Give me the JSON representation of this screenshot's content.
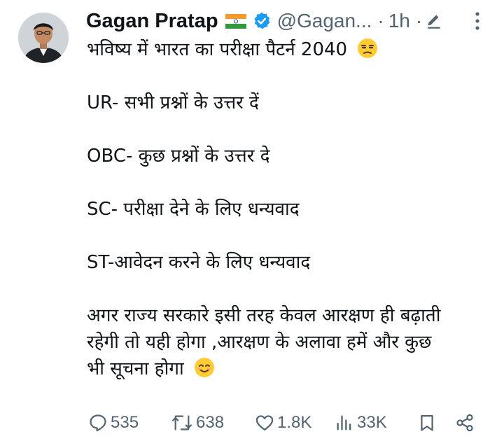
{
  "author": {
    "name": "Gagan Pratap",
    "handle": "@Gagan...",
    "time": "1h",
    "separator": "·"
  },
  "icons": {
    "avatar": "profile-photo",
    "flag": "india-flag-icon",
    "verified": "verified-badge-icon",
    "edit": "pencil-icon",
    "more": "more-vertical-icon",
    "emoji_1": "unamused-face-emoji",
    "emoji_2": "smiling-face-emoji"
  },
  "colors": {
    "text": "#0f1419",
    "muted": "#536471",
    "verified": "#1d9bf0",
    "emoji": "#ffcc33"
  },
  "tweet": {
    "line_1": "भविष्य में भारत का परीक्षा पैटर्न 2040",
    "line_2": "UR- सभी प्रश्नों के उत्तर दें",
    "line_3": "OBC- कुछ प्रश्नों के उत्तर दे",
    "line_4": "SC- परीक्षा देने के लिए धन्यवाद",
    "line_5": "ST-आवेदन करने के लिए धन्यवाद",
    "line_6": "अगर राज्य सरकारे इसी तरह केवल आरक्षण ही बढ़ाती",
    "line_7": "रहेगी तो यही होगा ,आरक्षण के अलावा हमें और कुछ",
    "line_8": "भी सूचना होगा"
  },
  "actions": {
    "replies": "535",
    "reposts": "638",
    "likes": "1.8K",
    "views": "33K"
  }
}
